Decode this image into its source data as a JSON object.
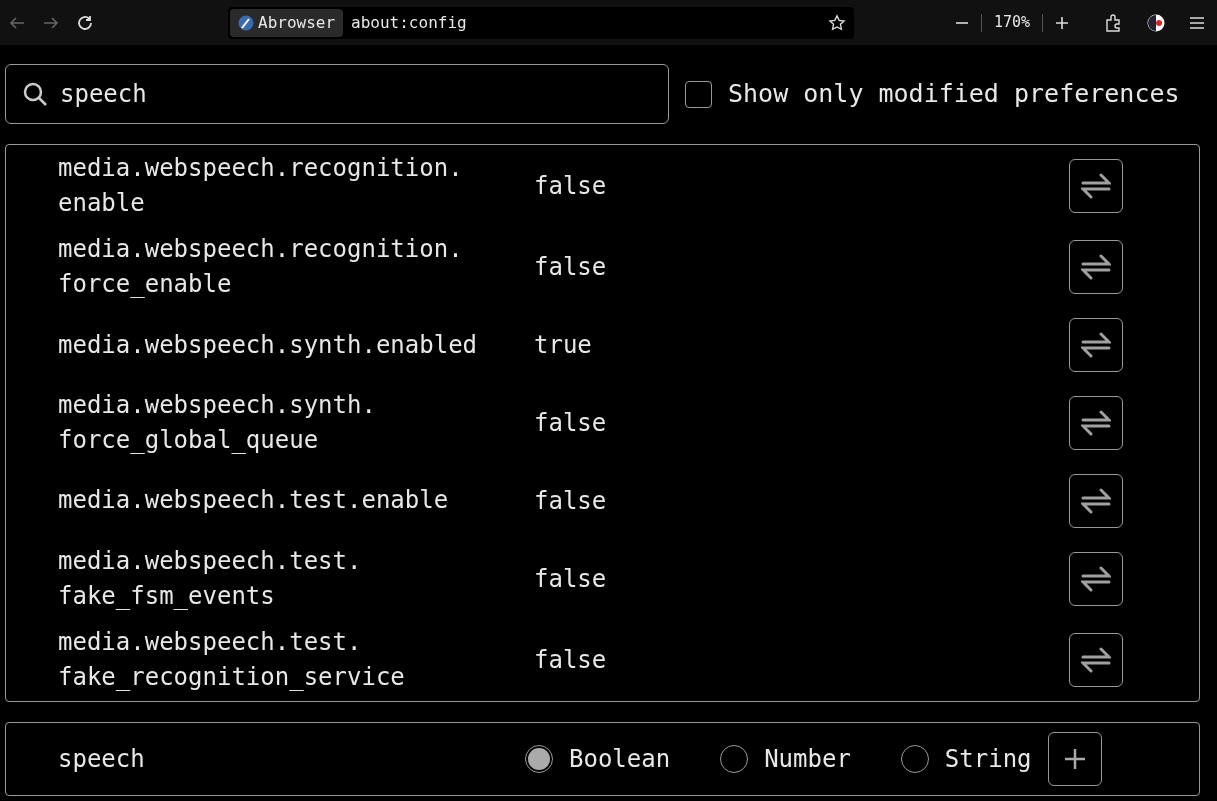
{
  "toolbar": {
    "site_label": "Abrowser",
    "url": "about:config",
    "zoom": "170%"
  },
  "search": {
    "value": "speech"
  },
  "modified_filter": {
    "label": "Show only modified preferences",
    "checked": false
  },
  "preferences": [
    {
      "name": "media.webspeech.recognition.enable",
      "value": "false"
    },
    {
      "name": "media.webspeech.recognition.force_enable",
      "value": "false"
    },
    {
      "name": "media.webspeech.synth.enabled",
      "value": "true"
    },
    {
      "name": "media.webspeech.synth.force_global_queue",
      "value": "false"
    },
    {
      "name": "media.webspeech.test.enable",
      "value": "false"
    },
    {
      "name": "media.webspeech.test.fake_fsm_events",
      "value": "false"
    },
    {
      "name": "media.webspeech.test.fake_recognition_service",
      "value": "false"
    }
  ],
  "new_preference": {
    "name": "speech",
    "types": [
      {
        "label": "Boolean",
        "selected": true
      },
      {
        "label": "Number",
        "selected": false
      },
      {
        "label": "String",
        "selected": false
      }
    ]
  }
}
